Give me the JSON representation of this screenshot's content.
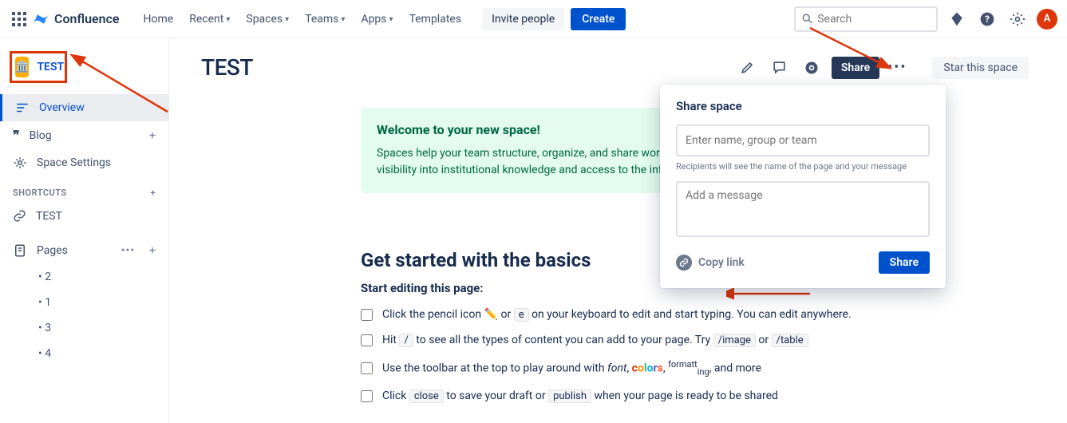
{
  "nav": {
    "brand": "Confluence",
    "items": [
      "Home",
      "Recent",
      "Spaces",
      "Teams",
      "Apps",
      "Templates"
    ],
    "invite": "Invite people",
    "create": "Create",
    "search_placeholder": "Search",
    "avatar_initial": "A"
  },
  "sidebar": {
    "space_name": "TEST",
    "items": [
      {
        "label": "Overview"
      },
      {
        "label": "Blog"
      },
      {
        "label": "Space Settings"
      }
    ],
    "shortcuts_label": "SHORTCUTS",
    "shortcuts": [
      {
        "label": "TEST"
      }
    ],
    "pages_label": "Pages",
    "pages": [
      "2",
      "1",
      "3",
      "4"
    ]
  },
  "page": {
    "title": "TEST",
    "share_btn": "Share",
    "star_btn": "Star this space"
  },
  "banner": {
    "title": "Welcome to your new space!",
    "text": "Spaces help your team structure, organize, and share work, so every team member has visibility into institutional knowledge and access to the information they need."
  },
  "basics": {
    "heading": "Get started with the basics",
    "sub": "Start editing this page:",
    "line1a": "Click the pencil icon ",
    "line1b": " or ",
    "line1c": " on your keyboard to edit and start typing. You can edit anywhere.",
    "key_e": "e",
    "line2a": "Hit ",
    "line2b": " to see all the types of content you can add to your page. Try ",
    "line2c": " or ",
    "key_slash": "/",
    "key_image": "/image",
    "key_table": "/table",
    "line3a": "Use the toolbar at the top to play around with ",
    "line3b": ", and more",
    "font": "font",
    "colors": "colors",
    "formatt": "formatt",
    "ing": "ing",
    "line4a": "Click ",
    "line4b": " to save your draft or ",
    "line4c": " when your page is ready to be shared",
    "key_close": "close",
    "key_publish": "publish"
  },
  "popover": {
    "title": "Share space",
    "input_placeholder": "Enter name, group or team",
    "hint": "Recipients will see the name of the page and your message",
    "msg_placeholder": "Add a message",
    "copy_link": "Copy link",
    "share": "Share"
  }
}
